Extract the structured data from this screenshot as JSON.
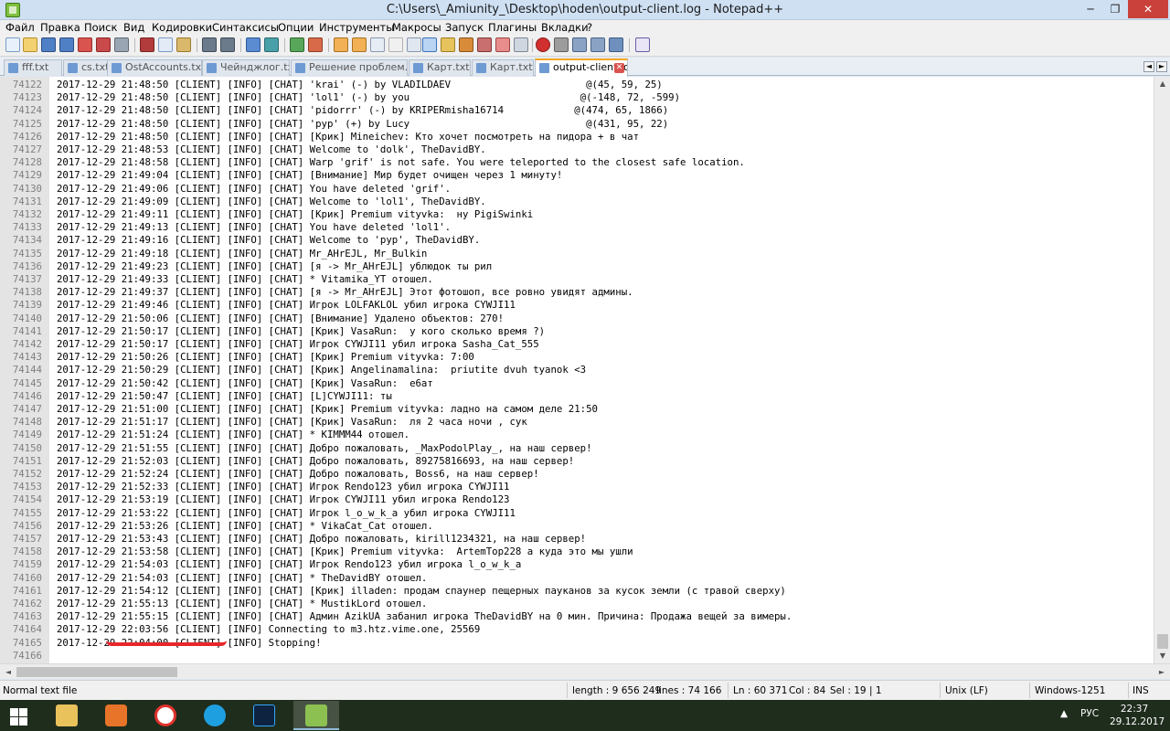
{
  "window": {
    "title": "C:\\Users\\_Amiunity_\\Desktop\\hoden\\output-client.log - Notepad++",
    "minimize_glyph": "─",
    "maximize_glyph": "❐",
    "close_glyph": "✕"
  },
  "menu": [
    "Файл",
    "Правка",
    "Поиск",
    "Вид",
    "Кодировки",
    "Синтаксисы",
    "Опции",
    "Инструменты",
    "Макросы",
    "Запуск",
    "Плагины",
    "Вкладки",
    "?"
  ],
  "tabs": [
    {
      "label": "fff.txt",
      "active": false
    },
    {
      "label": "cs.txt",
      "active": false
    },
    {
      "label": "OstAccounts.txt",
      "active": false
    },
    {
      "label": "Чейнджлог.txt",
      "active": false
    },
    {
      "label": "Решение проблем.txt",
      "active": false
    },
    {
      "label": "Карт.txt",
      "active": false
    },
    {
      "label": "Карт.txt",
      "active": false
    },
    {
      "label": "output-client.log",
      "active": true
    }
  ],
  "tab_close_glyph": "✕",
  "tab_scroll": {
    "left": "◄",
    "right": "►"
  },
  "editor": {
    "lines": [
      {
        "n": "74122",
        "text": "2017-12-29 21:48:50 [CLIENT] [INFO] [CHAT] 'krai' (-) by VLADILDAEV                       @(45, 59, 25)"
      },
      {
        "n": "74123",
        "text": "2017-12-29 21:48:50 [CLIENT] [INFO] [CHAT] 'lol1' (-) by you                             @(-148, 72, -599)"
      },
      {
        "n": "74124",
        "text": "2017-12-29 21:48:50 [CLIENT] [INFO] [CHAT] 'pidorrr' (-) by KRIPERmisha16714            @(474, 65, 1866)"
      },
      {
        "n": "74125",
        "text": "2017-12-29 21:48:50 [CLIENT] [INFO] [CHAT] 'pyp' (+) by Lucy                              @(431, 95, 22)"
      },
      {
        "n": "74126",
        "text": "2017-12-29 21:48:50 [CLIENT] [INFO] [CHAT] [Крик] Mineichev: Кто хочет посмотреть на пидора + в чат"
      },
      {
        "n": "74127",
        "text": "2017-12-29 21:48:53 [CLIENT] [INFO] [CHAT] Welcome to 'dolk', TheDavidBY."
      },
      {
        "n": "74128",
        "text": "2017-12-29 21:48:58 [CLIENT] [INFO] [CHAT] Warp 'grif' is not safe. You were teleported to the closest safe location."
      },
      {
        "n": "74129",
        "text": "2017-12-29 21:49:04 [CLIENT] [INFO] [CHAT] [Внимание] Мир будет очищен через 1 минуту!"
      },
      {
        "n": "74130",
        "text": "2017-12-29 21:49:06 [CLIENT] [INFO] [CHAT] You have deleted 'grif'."
      },
      {
        "n": "74131",
        "text": "2017-12-29 21:49:09 [CLIENT] [INFO] [CHAT] Welcome to 'lol1', TheDavidBY."
      },
      {
        "n": "74132",
        "text": "2017-12-29 21:49:11 [CLIENT] [INFO] [CHAT] [Крик] Premium vityvka:  ну PigiSwinki"
      },
      {
        "n": "74133",
        "text": "2017-12-29 21:49:13 [CLIENT] [INFO] [CHAT] You have deleted 'lol1'."
      },
      {
        "n": "74134",
        "text": "2017-12-29 21:49:16 [CLIENT] [INFO] [CHAT] Welcome to 'pyp', TheDavidBY."
      },
      {
        "n": "74135",
        "text": "2017-12-29 21:49:18 [CLIENT] [INFO] [CHAT] Mr_AHrEJL, Mr_Bulkin"
      },
      {
        "n": "74136",
        "text": "2017-12-29 21:49:23 [CLIENT] [INFO] [CHAT] [я -> Mr_AHrEJL] ублюдок ты рил"
      },
      {
        "n": "74137",
        "text": "2017-12-29 21:49:33 [CLIENT] [INFO] [CHAT] * Vitamika_YT отошел."
      },
      {
        "n": "74138",
        "text": "2017-12-29 21:49:37 [CLIENT] [INFO] [CHAT] [я -> Mr_AHrEJL] Этот фотошоп, все ровно увидят админы."
      },
      {
        "n": "74139",
        "text": "2017-12-29 21:49:46 [CLIENT] [INFO] [CHAT] Игрок LOLFAKLOL убил игрока CYWJI11"
      },
      {
        "n": "74140",
        "text": "2017-12-29 21:50:06 [CLIENT] [INFO] [CHAT] [Внимание] Удалено объектов: 270!"
      },
      {
        "n": "74141",
        "text": "2017-12-29 21:50:17 [CLIENT] [INFO] [CHAT] [Крик] VasaRun:  у кого сколько время ?)"
      },
      {
        "n": "74142",
        "text": "2017-12-29 21:50:17 [CLIENT] [INFO] [CHAT] Игрок CYWJI11 убил игрока Sasha_Cat_555"
      },
      {
        "n": "74143",
        "text": "2017-12-29 21:50:26 [CLIENT] [INFO] [CHAT] [Крик] Premium vityvka: 7:00"
      },
      {
        "n": "74144",
        "text": "2017-12-29 21:50:29 [CLIENT] [INFO] [CHAT] [Крик] Angelinamalina:  priutite dvuh tyanok <3"
      },
      {
        "n": "74145",
        "text": "2017-12-29 21:50:42 [CLIENT] [INFO] [CHAT] [Крик] VasaRun:  е6ат"
      },
      {
        "n": "74146",
        "text": "2017-12-29 21:50:47 [CLIENT] [INFO] [CHAT] [L]CYWJI11: ты"
      },
      {
        "n": "74147",
        "text": "2017-12-29 21:51:00 [CLIENT] [INFO] [CHAT] [Крик] Premium vityvka: ладно на самом деле 21:50"
      },
      {
        "n": "74148",
        "text": "2017-12-29 21:51:17 [CLIENT] [INFO] [CHAT] [Крик] VasaRun:  ля 2 часа ночи , сук"
      },
      {
        "n": "74149",
        "text": "2017-12-29 21:51:24 [CLIENT] [INFO] [CHAT] * KIMMM44 отошел."
      },
      {
        "n": "74150",
        "text": "2017-12-29 21:51:55 [CLIENT] [INFO] [CHAT] Добро пожаловать, _MaxPodolPlay_, на наш сервер!"
      },
      {
        "n": "74151",
        "text": "2017-12-29 21:52:03 [CLIENT] [INFO] [CHAT] Добро пожаловать, 89275816693, на наш сервер!"
      },
      {
        "n": "74152",
        "text": "2017-12-29 21:52:24 [CLIENT] [INFO] [CHAT] Добро пожаловать, Boss6, на наш сервер!"
      },
      {
        "n": "74153",
        "text": "2017-12-29 21:52:33 [CLIENT] [INFO] [CHAT] Игрок Rendo123 убил игрока CYWJI11"
      },
      {
        "n": "74154",
        "text": "2017-12-29 21:53:19 [CLIENT] [INFO] [CHAT] Игрок CYWJI11 убил игрока Rendo123"
      },
      {
        "n": "74155",
        "text": "2017-12-29 21:53:22 [CLIENT] [INFO] [CHAT] Игрок l_o_w_k_a убил игрока CYWJI11"
      },
      {
        "n": "74156",
        "text": "2017-12-29 21:53:26 [CLIENT] [INFO] [CHAT] * VikaCat_Cat отошел."
      },
      {
        "n": "74157",
        "text": "2017-12-29 21:53:43 [CLIENT] [INFO] [CHAT] Добро пожаловать, kirill1234321, на наш сервер!"
      },
      {
        "n": "74158",
        "text": "2017-12-29 21:53:58 [CLIENT] [INFO] [CHAT] [Крик] Premium vityvka:  ArtemTop228 а куда это мы ушли"
      },
      {
        "n": "74159",
        "text": "2017-12-29 21:54:03 [CLIENT] [INFO] [CHAT] Игрок Rendo123 убил игрока l_o_w_k_a"
      },
      {
        "n": "74160",
        "text": "2017-12-29 21:54:03 [CLIENT] [INFO] [CHAT] * TheDavidBY отошел."
      },
      {
        "n": "74161",
        "text": "2017-12-29 21:54:12 [CLIENT] [INFO] [CHAT] [Крик] illaden: продам спаунер пещерных пауканов за кусок земли (с травой сверху)"
      },
      {
        "n": "74162",
        "text": "2017-12-29 21:55:13 [CLIENT] [INFO] [CHAT] * MustikLord отошел."
      },
      {
        "n": "74163",
        "text": "2017-12-29 21:55:15 [CLIENT] [INFO] [CHAT] Админ AzikUA забанил игрока TheDavidBY на 0 мин. Причина: Продажа вещей за вимеры."
      },
      {
        "n": "74164",
        "text": "2017-12-29 22:03:56 [CLIENT] [INFO] Connecting to m3.htz.vime.one, 25569"
      },
      {
        "n": "74165",
        "text": "2017-12-29 22:04:00 [CLIENT] [INFO] Stopping!"
      },
      {
        "n": "74166",
        "text": ""
      }
    ]
  },
  "scroll_arrows": {
    "up": "▲",
    "down": "▼",
    "left": "◄",
    "right": "►"
  },
  "status": {
    "file_type": "Normal text file",
    "length": "length : 9 656 249",
    "lines": "lines : 74 166",
    "ln": "Ln : 60 371",
    "col": "Col : 84",
    "sel": "Sel : 19 | 1",
    "eol": "Unix (LF)",
    "encoding": "Windows-1251",
    "mode": "INS"
  },
  "taskbar": {
    "tray_arrow": "▲",
    "language": "РУС",
    "time": "22:37",
    "date": "29.12.2017"
  },
  "colors": {
    "accent": "#f5a623",
    "underline": "#e8262b",
    "taskbar": "#1f2d1d"
  }
}
